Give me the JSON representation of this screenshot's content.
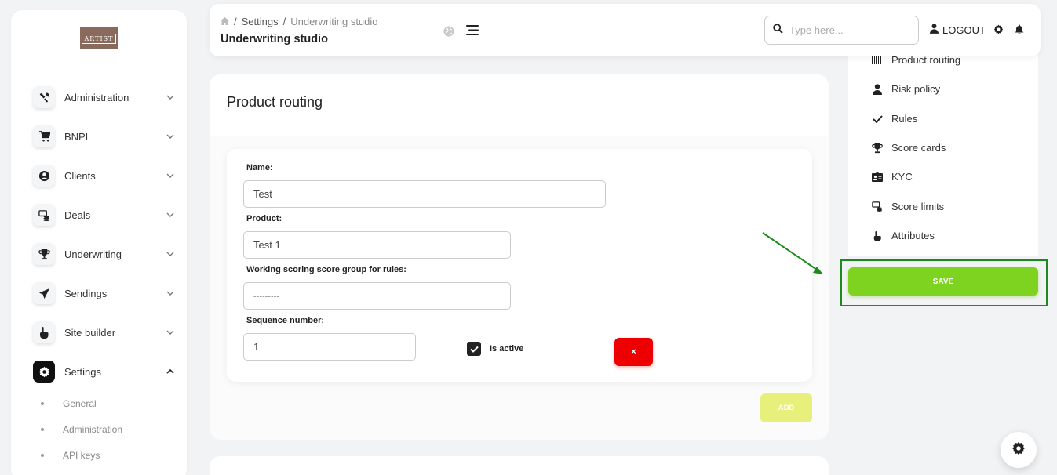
{
  "sidebar": {
    "logo_text": "ARTIST",
    "items": [
      {
        "label": "Administration",
        "icon": "tools-icon"
      },
      {
        "label": "BNPL",
        "icon": "cart-icon"
      },
      {
        "label": "Clients",
        "icon": "user-circle-icon"
      },
      {
        "label": "Deals",
        "icon": "money-stack-icon"
      },
      {
        "label": "Underwriting",
        "icon": "trophy-icon"
      },
      {
        "label": "Sendings",
        "icon": "paper-plane-icon"
      },
      {
        "label": "Site builder",
        "icon": "hand-pointer-icon"
      },
      {
        "label": "Settings",
        "icon": "gear-icon",
        "expanded": true
      }
    ],
    "sub_items": [
      {
        "label": "General"
      },
      {
        "label": "Administration"
      },
      {
        "label": "API keys"
      }
    ]
  },
  "header": {
    "breadcrumb": {
      "sep1": "/",
      "crumb1": "Settings",
      "sep2": "/",
      "crumb2": "Underwriting studio"
    },
    "title": "Underwriting studio",
    "search_placeholder": "Type here...",
    "logout_label": "LOGOUT"
  },
  "main": {
    "title": "Product routing",
    "form": {
      "name_label": "Name:",
      "name_value": "Test",
      "product_label": "Product:",
      "product_value": "Test 1",
      "group_label": "Working scoring score group for rules:",
      "group_value": "---------",
      "sequence_label": "Sequence number:",
      "sequence_value": "1",
      "active_label": "Is active",
      "is_active": true,
      "remove_label": "×"
    },
    "add_label": "ADD"
  },
  "right_panel": {
    "items": [
      {
        "label": "Product routing",
        "icon": "barcode-icon"
      },
      {
        "label": "Risk policy",
        "icon": "user-icon"
      },
      {
        "label": "Rules",
        "icon": "check-icon"
      },
      {
        "label": "Score cards",
        "icon": "trophy-icon"
      },
      {
        "label": "KYC",
        "icon": "id-card-icon"
      },
      {
        "label": "Score limits",
        "icon": "money-stack-icon"
      },
      {
        "label": "Attributes",
        "icon": "hand-pointer-icon"
      }
    ],
    "save_label": "SAVE"
  },
  "colors": {
    "save": "#7ed321",
    "add": "#e6f07a",
    "remove": "#ee0000",
    "highlight_box": "#1c8a1c",
    "active_nav": "#111111"
  }
}
